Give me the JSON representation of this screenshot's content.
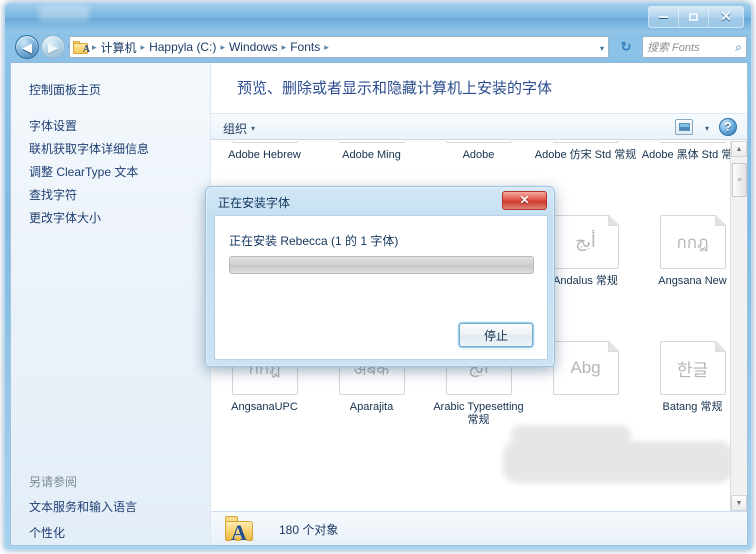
{
  "window": {
    "controls": {
      "minimize": "—",
      "maximize": "□",
      "close": "✕"
    }
  },
  "navbar": {
    "back_arrow": "◀",
    "forward_arrow": "▶",
    "history_caret": "▾",
    "breadcrumbs": [
      "计算机",
      "Happyla (C:)",
      "Windows",
      "Fonts"
    ],
    "separator": "▸",
    "address_caret": "▾",
    "refresh_glyph": "↻",
    "search_placeholder": "搜索 Fonts",
    "search_glyph": "🔍"
  },
  "sidebar": {
    "top_items": [
      {
        "label": "控制面板主页"
      },
      {
        "label": "字体设置"
      },
      {
        "label": "联机获取字体详细信息"
      },
      {
        "label": "调整 ClearType 文本"
      },
      {
        "label": "查找字符"
      },
      {
        "label": "更改字体大小"
      }
    ],
    "see_also_header": "另请参阅",
    "see_also_items": [
      {
        "label": "文本服务和输入语言"
      },
      {
        "label": "个性化"
      }
    ]
  },
  "content": {
    "heading": "预览、删除或者显示和隐藏计算机上安装的字体",
    "toolbar": {
      "organize_label": "组织",
      "organize_caret": "▾",
      "view_caret": "▾",
      "help_label": "?"
    },
    "fonts": [
      {
        "sample": "",
        "name": "Adobe Hebrew",
        "stack": false
      },
      {
        "sample": "",
        "name": "Adobe Ming",
        "stack": true
      },
      {
        "sample": "",
        "name": "Adobe",
        "stack": false
      },
      {
        "sample": "",
        "name": "Adobe 仿宋 Std 常规",
        "stack": false
      },
      {
        "sample": "",
        "name": "Adobe 黑体 Std 常规",
        "stack": false
      },
      {
        "sample": "أبج",
        "name": "Andalus 常规",
        "stack": false
      },
      {
        "sample": "กกฎ",
        "name": "Angsana New",
        "stack": true
      },
      {
        "sample": "กกฎ",
        "name": "AngsanaUPC",
        "stack": true
      },
      {
        "sample": "अबक",
        "name": "Aparajita",
        "stack": true
      },
      {
        "sample": "أبج",
        "name": "Arabic Typesetting 常规",
        "stack": false
      },
      {
        "sample": "Abg",
        "name": "",
        "stack": true
      },
      {
        "sample": "한글",
        "name": "Batang 常规",
        "stack": false
      }
    ],
    "scrollbar": {
      "up_glyph": "▲",
      "down_glyph": "▼",
      "thumb_glyph": "≡"
    },
    "status": {
      "count_label": "180 个对象",
      "folder_letter": "A"
    }
  },
  "dialog": {
    "title": "正在安装字体",
    "close_glyph": "✕",
    "message": "正在安装 Rebecca (1 的 1 字体)",
    "progress_percent": 0,
    "stop_label": "停止"
  }
}
